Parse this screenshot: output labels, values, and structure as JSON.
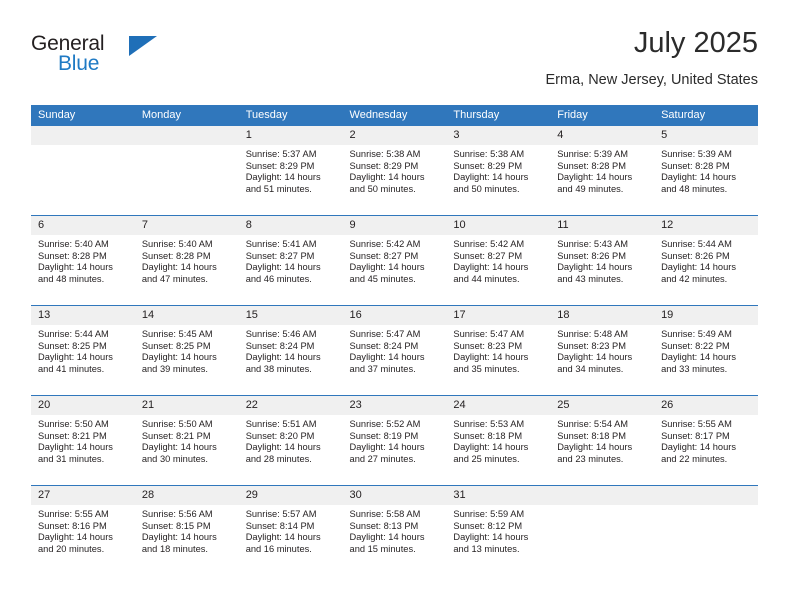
{
  "brand": {
    "name_top": "General",
    "name_bottom": "Blue",
    "accent_color": "#1f7ac4",
    "triangle_color": "#1f6fb8"
  },
  "header": {
    "title": "July 2025",
    "location": "Erma, New Jersey, United States",
    "header_bar_color": "#3077bc",
    "daynum_band_color": "#f0f0f0"
  },
  "weekday_headers": [
    "Sunday",
    "Monday",
    "Tuesday",
    "Wednesday",
    "Thursday",
    "Friday",
    "Saturday"
  ],
  "labels": {
    "sunrise": "Sunrise:",
    "sunset": "Sunset:",
    "daylight": "Daylight:"
  },
  "weeks": [
    [
      {
        "day": "",
        "empty": true
      },
      {
        "day": "",
        "empty": true
      },
      {
        "day": "1",
        "sunrise": "Sunrise: 5:37 AM",
        "sunset": "Sunset: 8:29 PM",
        "daylight_1": "Daylight: 14 hours",
        "daylight_2": "and 51 minutes."
      },
      {
        "day": "2",
        "sunrise": "Sunrise: 5:38 AM",
        "sunset": "Sunset: 8:29 PM",
        "daylight_1": "Daylight: 14 hours",
        "daylight_2": "and 50 minutes."
      },
      {
        "day": "3",
        "sunrise": "Sunrise: 5:38 AM",
        "sunset": "Sunset: 8:29 PM",
        "daylight_1": "Daylight: 14 hours",
        "daylight_2": "and 50 minutes."
      },
      {
        "day": "4",
        "sunrise": "Sunrise: 5:39 AM",
        "sunset": "Sunset: 8:28 PM",
        "daylight_1": "Daylight: 14 hours",
        "daylight_2": "and 49 minutes."
      },
      {
        "day": "5",
        "sunrise": "Sunrise: 5:39 AM",
        "sunset": "Sunset: 8:28 PM",
        "daylight_1": "Daylight: 14 hours",
        "daylight_2": "and 48 minutes."
      }
    ],
    [
      {
        "day": "6",
        "sunrise": "Sunrise: 5:40 AM",
        "sunset": "Sunset: 8:28 PM",
        "daylight_1": "Daylight: 14 hours",
        "daylight_2": "and 48 minutes."
      },
      {
        "day": "7",
        "sunrise": "Sunrise: 5:40 AM",
        "sunset": "Sunset: 8:28 PM",
        "daylight_1": "Daylight: 14 hours",
        "daylight_2": "and 47 minutes."
      },
      {
        "day": "8",
        "sunrise": "Sunrise: 5:41 AM",
        "sunset": "Sunset: 8:27 PM",
        "daylight_1": "Daylight: 14 hours",
        "daylight_2": "and 46 minutes."
      },
      {
        "day": "9",
        "sunrise": "Sunrise: 5:42 AM",
        "sunset": "Sunset: 8:27 PM",
        "daylight_1": "Daylight: 14 hours",
        "daylight_2": "and 45 minutes."
      },
      {
        "day": "10",
        "sunrise": "Sunrise: 5:42 AM",
        "sunset": "Sunset: 8:27 PM",
        "daylight_1": "Daylight: 14 hours",
        "daylight_2": "and 44 minutes."
      },
      {
        "day": "11",
        "sunrise": "Sunrise: 5:43 AM",
        "sunset": "Sunset: 8:26 PM",
        "daylight_1": "Daylight: 14 hours",
        "daylight_2": "and 43 minutes."
      },
      {
        "day": "12",
        "sunrise": "Sunrise: 5:44 AM",
        "sunset": "Sunset: 8:26 PM",
        "daylight_1": "Daylight: 14 hours",
        "daylight_2": "and 42 minutes."
      }
    ],
    [
      {
        "day": "13",
        "sunrise": "Sunrise: 5:44 AM",
        "sunset": "Sunset: 8:25 PM",
        "daylight_1": "Daylight: 14 hours",
        "daylight_2": "and 41 minutes."
      },
      {
        "day": "14",
        "sunrise": "Sunrise: 5:45 AM",
        "sunset": "Sunset: 8:25 PM",
        "daylight_1": "Daylight: 14 hours",
        "daylight_2": "and 39 minutes."
      },
      {
        "day": "15",
        "sunrise": "Sunrise: 5:46 AM",
        "sunset": "Sunset: 8:24 PM",
        "daylight_1": "Daylight: 14 hours",
        "daylight_2": "and 38 minutes."
      },
      {
        "day": "16",
        "sunrise": "Sunrise: 5:47 AM",
        "sunset": "Sunset: 8:24 PM",
        "daylight_1": "Daylight: 14 hours",
        "daylight_2": "and 37 minutes."
      },
      {
        "day": "17",
        "sunrise": "Sunrise: 5:47 AM",
        "sunset": "Sunset: 8:23 PM",
        "daylight_1": "Daylight: 14 hours",
        "daylight_2": "and 35 minutes."
      },
      {
        "day": "18",
        "sunrise": "Sunrise: 5:48 AM",
        "sunset": "Sunset: 8:23 PM",
        "daylight_1": "Daylight: 14 hours",
        "daylight_2": "and 34 minutes."
      },
      {
        "day": "19",
        "sunrise": "Sunrise: 5:49 AM",
        "sunset": "Sunset: 8:22 PM",
        "daylight_1": "Daylight: 14 hours",
        "daylight_2": "and 33 minutes."
      }
    ],
    [
      {
        "day": "20",
        "sunrise": "Sunrise: 5:50 AM",
        "sunset": "Sunset: 8:21 PM",
        "daylight_1": "Daylight: 14 hours",
        "daylight_2": "and 31 minutes."
      },
      {
        "day": "21",
        "sunrise": "Sunrise: 5:50 AM",
        "sunset": "Sunset: 8:21 PM",
        "daylight_1": "Daylight: 14 hours",
        "daylight_2": "and 30 minutes."
      },
      {
        "day": "22",
        "sunrise": "Sunrise: 5:51 AM",
        "sunset": "Sunset: 8:20 PM",
        "daylight_1": "Daylight: 14 hours",
        "daylight_2": "and 28 minutes."
      },
      {
        "day": "23",
        "sunrise": "Sunrise: 5:52 AM",
        "sunset": "Sunset: 8:19 PM",
        "daylight_1": "Daylight: 14 hours",
        "daylight_2": "and 27 minutes."
      },
      {
        "day": "24",
        "sunrise": "Sunrise: 5:53 AM",
        "sunset": "Sunset: 8:18 PM",
        "daylight_1": "Daylight: 14 hours",
        "daylight_2": "and 25 minutes."
      },
      {
        "day": "25",
        "sunrise": "Sunrise: 5:54 AM",
        "sunset": "Sunset: 8:18 PM",
        "daylight_1": "Daylight: 14 hours",
        "daylight_2": "and 23 minutes."
      },
      {
        "day": "26",
        "sunrise": "Sunrise: 5:55 AM",
        "sunset": "Sunset: 8:17 PM",
        "daylight_1": "Daylight: 14 hours",
        "daylight_2": "and 22 minutes."
      }
    ],
    [
      {
        "day": "27",
        "sunrise": "Sunrise: 5:55 AM",
        "sunset": "Sunset: 8:16 PM",
        "daylight_1": "Daylight: 14 hours",
        "daylight_2": "and 20 minutes."
      },
      {
        "day": "28",
        "sunrise": "Sunrise: 5:56 AM",
        "sunset": "Sunset: 8:15 PM",
        "daylight_1": "Daylight: 14 hours",
        "daylight_2": "and 18 minutes."
      },
      {
        "day": "29",
        "sunrise": "Sunrise: 5:57 AM",
        "sunset": "Sunset: 8:14 PM",
        "daylight_1": "Daylight: 14 hours",
        "daylight_2": "and 16 minutes."
      },
      {
        "day": "30",
        "sunrise": "Sunrise: 5:58 AM",
        "sunset": "Sunset: 8:13 PM",
        "daylight_1": "Daylight: 14 hours",
        "daylight_2": "and 15 minutes."
      },
      {
        "day": "31",
        "sunrise": "Sunrise: 5:59 AM",
        "sunset": "Sunset: 8:12 PM",
        "daylight_1": "Daylight: 14 hours",
        "daylight_2": "and 13 minutes."
      },
      {
        "day": "",
        "empty": true
      },
      {
        "day": "",
        "empty": true
      }
    ]
  ]
}
